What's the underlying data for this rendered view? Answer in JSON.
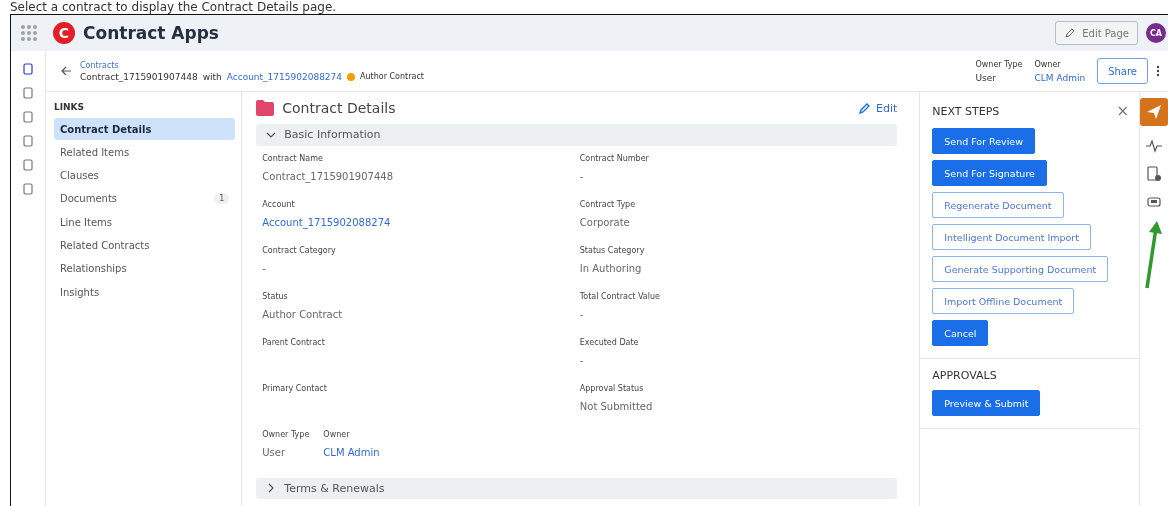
{
  "caption": "Select a contract to display the Contract Details page.",
  "app": {
    "logo_letter": "C",
    "title": "Contract Apps",
    "edit_page": "Edit Page",
    "avatar": "CA"
  },
  "header": {
    "breadcrumb": "Contracts",
    "contract": "Contract_1715901907448",
    "with": "with",
    "account": "Account_1715902088274",
    "status": "Author Contract",
    "owner_type_label": "Owner Type",
    "owner_type": "User",
    "owner_label": "Owner",
    "owner": "CLM Admin",
    "share": "Share"
  },
  "rail": [
    {
      "selected": true
    },
    {
      "selected": false
    },
    {
      "selected": false
    },
    {
      "selected": false
    },
    {
      "selected": false
    },
    {
      "selected": false
    }
  ],
  "links": {
    "title": "LINKS",
    "items": [
      {
        "label": "Contract Details",
        "selected": true
      },
      {
        "label": "Related Items",
        "selected": false
      },
      {
        "label": "Clauses",
        "selected": false
      },
      {
        "label": "Documents",
        "selected": false,
        "count": "1"
      },
      {
        "label": "Line Items",
        "selected": false
      },
      {
        "label": "Related Contracts",
        "selected": false
      },
      {
        "label": "Relationships",
        "selected": false
      },
      {
        "label": "Insights",
        "selected": false
      }
    ]
  },
  "details": {
    "title": "Contract Details",
    "edit": "Edit",
    "sections": [
      {
        "title": "Basic Information",
        "expanded": true
      },
      {
        "title": "Terms & Renewals",
        "expanded": false
      }
    ],
    "fields": [
      {
        "label": "Contract Name",
        "value": "Contract_1715901907448",
        "link": false
      },
      {
        "label": "Contract Number",
        "value": "-",
        "link": false
      },
      {
        "label": "Account",
        "value": "Account_1715902088274",
        "link": true
      },
      {
        "label": "Contract Type",
        "value": "Corporate",
        "link": false
      },
      {
        "label": "Contract Category",
        "value": "-",
        "link": false
      },
      {
        "label": "Status Category",
        "value": "In Authoring",
        "link": false
      },
      {
        "label": "Status",
        "value": "Author Contract",
        "link": false
      },
      {
        "label": "Total Contract Value",
        "value": "-",
        "link": false
      },
      {
        "label": "Parent Contract"
      },
      {
        "label": "Executed Date",
        "value": "-",
        "link": false
      },
      {
        "label": "Primary Contact"
      },
      {
        "label": "Approval Status",
        "value": "Not Submitted",
        "link": false
      }
    ],
    "owner": [
      {
        "label": "Owner Type",
        "value": "User",
        "link": false
      },
      {
        "label": "Owner",
        "value": "CLM Admin",
        "link": true
      }
    ]
  },
  "next_steps": {
    "title": "NEXT STEPS",
    "close": "×",
    "buttons": [
      {
        "label": "Send For Review",
        "kind": "primary"
      },
      {
        "label": "Send For Signature",
        "kind": "primary"
      },
      {
        "label": "Regenerate Document",
        "kind": "outline"
      },
      {
        "label": "Intelligent Document Import",
        "kind": "outline"
      },
      {
        "label": "Generate Supporting Document",
        "kind": "outline"
      },
      {
        "label": "Import Offline Document",
        "kind": "outline"
      },
      {
        "label": "Cancel",
        "kind": "primary"
      }
    ]
  },
  "approvals": {
    "title": "APPROVALS",
    "buttons": [
      {
        "label": "Preview & Submit",
        "kind": "primary"
      }
    ]
  },
  "right_rail": [
    {
      "selected": true
    },
    {
      "selected": false
    },
    {
      "selected": false
    },
    {
      "selected": false
    }
  ]
}
